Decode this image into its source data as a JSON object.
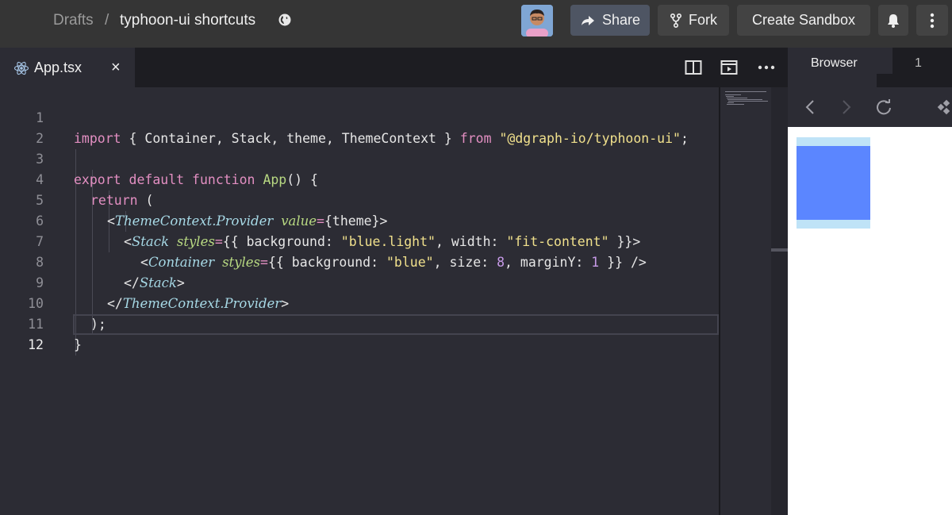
{
  "header": {
    "breadcrumb_root": "Drafts",
    "breadcrumb_separator": "/",
    "sandbox_title": "typhoon-ui shortcuts",
    "privacy_icon": "globe-icon",
    "share_label": "Share",
    "fork_label": "Fork",
    "create_label": "Create Sandbox"
  },
  "editor": {
    "tab_label": "App.tsx",
    "tab_close": "×",
    "lines": [
      {
        "n": "1"
      },
      {
        "n": "2"
      },
      {
        "n": "3"
      },
      {
        "n": "4"
      },
      {
        "n": "5"
      },
      {
        "n": "6"
      },
      {
        "n": "7"
      },
      {
        "n": "8"
      },
      {
        "n": "9"
      },
      {
        "n": "10"
      },
      {
        "n": "11"
      },
      {
        "n": "12"
      }
    ],
    "code": {
      "l1": {
        "import": "import",
        "p1": " { Container, Stack, theme, ThemeContext } ",
        "from": "from",
        "p2": " ",
        "mod": "\"@dgraph-io/typhoon-ui\"",
        "p3": ";"
      },
      "l3": {
        "export": "export",
        "default": " default ",
        "function": "function",
        "p1": " ",
        "name": "App",
        "p2": "() {"
      },
      "l4": {
        "return": "return",
        "p1": " ("
      },
      "l5": {
        "open": "<",
        "tag": "ThemeContext.Provider",
        "p1": " ",
        "attr": "value",
        "eq": "=",
        "p2": "{theme}>"
      },
      "l6": {
        "open": "<",
        "tag": "Stack",
        "p1": " ",
        "attr": "styles",
        "eq": "=",
        "p2": "{{ background: ",
        "s1": "\"blue.light\"",
        "p3": ", width: ",
        "s2": "\"fit-content\"",
        "p4": " }}>"
      },
      "l7": {
        "open": "<",
        "tag": "Container",
        "p1": " ",
        "attr": "styles",
        "eq": "=",
        "p2": "{{ background: ",
        "s1": "\"blue\"",
        "p3": ", size: ",
        "n1": "8",
        "p4": ", marginY: ",
        "n2": "1",
        "p5": " }} />"
      },
      "l8": {
        "open": "</",
        "tag": "Stack",
        "close": ">"
      },
      "l9": {
        "open": "</",
        "tag": "ThemeContext.Provider",
        "close": ">"
      },
      "l10": {
        "text": ");"
      },
      "l11": {
        "text": "}"
      }
    }
  },
  "browser": {
    "tab_label": "Browser",
    "tab2_label": "1"
  },
  "colors": {
    "preview_outer": "#bfe3f7",
    "preview_inner": "#5b86ff",
    "share_bg": "#4e5563"
  }
}
